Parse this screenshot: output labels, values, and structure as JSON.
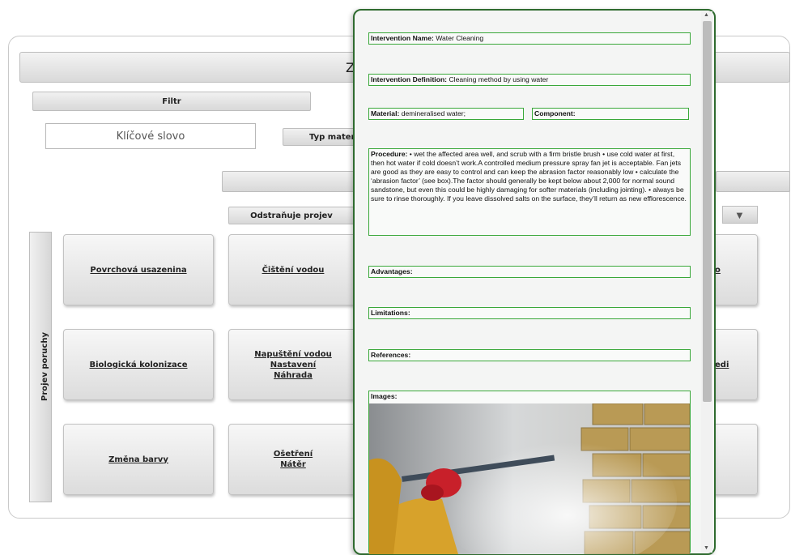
{
  "app": {
    "title_fragment": "Z",
    "filter_label": "Filtr",
    "keyword_placeholder": "Klíčové slovo",
    "material_type_label": "Typ materi",
    "removes_label": "Odstraňuje projev",
    "vertical_label": "Projev poruchy",
    "cards": [
      {
        "lines": [
          "Povrchová usazenina"
        ]
      },
      {
        "lines": [
          "Čištění vodou"
        ]
      },
      {
        "lines": [
          "Biologická kolonizace"
        ]
      },
      {
        "lines": [
          "Napuštění vodou",
          "Nastavení",
          "Náhrada"
        ]
      },
      {
        "lines": [
          "Změna barvy"
        ]
      },
      {
        "lines": [
          "Ošetření",
          "Nátěr"
        ]
      }
    ],
    "right_fragments": [
      "o",
      "edi"
    ]
  },
  "popup": {
    "name_label": "Intervention Name:",
    "name_value": "Water Cleaning",
    "definition_label": "Intervention Definition:",
    "definition_value": "Cleaning method by using water",
    "material_label": "Material:",
    "material_value": "demineralised water;",
    "component_label": "Component:",
    "component_value": "",
    "procedure_label": "Procedure:",
    "procedure_value": "• wet the affected area well, and scrub with a firm bristle brush • use cold water at first, then hot water if cold doesn’t work.A controlled medium pressure spray fan jet is acceptable. Fan jets are good as they are easy to control and can keep the abrasion factor reasonably low • calculate the ‘abrasion factor’ (see box).The factor should generally be kept below about 2,000 for normal sound sandstone, but even this could be highly damaging for softer materials (including jointing). • always be sure to rinse thoroughly. If you leave dissolved salts on the surface, they’ll return as new efflorescence.",
    "advantages_label": "Advantages:",
    "limitations_label": "Limitations:",
    "references_label": "References:",
    "images_label": "Images:"
  },
  "colors": {
    "field_border": "#3aa83a",
    "popup_border": "#2f6b2f"
  },
  "icons": [
    "down-arrow-icon",
    "scroll-up-icon",
    "scroll-down-icon"
  ]
}
